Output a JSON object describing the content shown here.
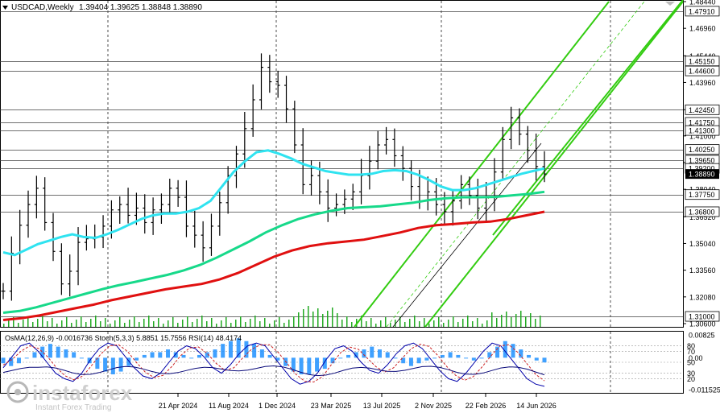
{
  "header": {
    "symbol": "USDCAD,Weekly",
    "ohlc": "1.39404 1.39625 1.38848 1.38890",
    "indicator_line": "OsMA(12,26,9) -0.0016736  Stoch(5,3,3) 5.8851 15.7556  RSI(14) 48.4174"
  },
  "brand": {
    "name": "instaforex",
    "tagline": "Instant Forex Trading"
  },
  "colors": {
    "ma_fast": "#2fe3f0",
    "ma_mid": "#17d98a",
    "ma_slow": "#e01010",
    "channel": "#33cc11",
    "candle": "#000000",
    "volume": "#22aa22",
    "osma": "#1e90ff",
    "stoch_main": "#0000aa",
    "stoch_signal": "#cc2222"
  },
  "chart_data": [
    {
      "type": "line",
      "title": "USDCAD,Weekly",
      "ylim": [
        1.306,
        1.4844
      ],
      "y_ticks": [
        "1.48440",
        "1.46960",
        "1.45440",
        "1.43960",
        "1.42450",
        "1.41000",
        "1.39520",
        "1.38040",
        "1.36520",
        "1.35040",
        "1.33560",
        "1.32080",
        "1.30600"
      ],
      "level_labels": [
        "1.47910",
        "1.45150",
        "1.44600",
        "1.42450",
        "1.41750",
        "1.41300",
        "1.40250",
        "1.39650",
        "1.39200",
        "1.37750",
        "1.36800",
        "1.31000"
      ],
      "x_ticks": [
        "21 Apr 2024",
        "11 Aug 2024",
        "1 Dec 2024",
        "23 Mar 2025",
        "13 Jul 2025",
        "2 Nov 2025",
        "22 Feb 2026",
        "14 Jun 2026"
      ],
      "price_close": [
        1.324,
        1.345,
        1.3605,
        1.372,
        1.381,
        1.362,
        1.346,
        1.328,
        1.335,
        1.351,
        1.353,
        1.354,
        1.36,
        1.369,
        1.372,
        1.366,
        1.37,
        1.362,
        1.369,
        1.372,
        1.381,
        1.376,
        1.36,
        1.355,
        1.348,
        1.36,
        1.373,
        1.388,
        1.4,
        1.414,
        1.43,
        1.448,
        1.44,
        1.438,
        1.425,
        1.405,
        1.383,
        1.388,
        1.379,
        1.37,
        1.372,
        1.375,
        1.379,
        1.388,
        1.396,
        1.405,
        1.408,
        1.399,
        1.392,
        1.382,
        1.374,
        1.379,
        1.372,
        1.368,
        1.374,
        1.383,
        1.377,
        1.37,
        1.376,
        1.39,
        1.408,
        1.42,
        1.411,
        1.402,
        1.393,
        1.3889
      ],
      "series": [
        {
          "name": "MA fast",
          "values": [
            1.3455,
            1.344,
            1.347,
            1.35,
            1.352,
            1.354,
            1.3555,
            1.354,
            1.3535,
            1.3555,
            1.358,
            1.361,
            1.364,
            1.366,
            1.367,
            1.367,
            1.368,
            1.37,
            1.374,
            1.382,
            1.39,
            1.396,
            1.401,
            1.402,
            1.4,
            1.3975,
            1.3945,
            1.3925,
            1.3905,
            1.3895,
            1.3885,
            1.3885,
            1.389,
            1.3905,
            1.391,
            1.3905,
            1.3885,
            1.3855,
            1.382,
            1.38,
            1.38,
            1.381,
            1.383,
            1.385,
            1.387,
            1.389,
            1.3905,
            1.392
          ]
        },
        {
          "name": "MA mid",
          "values": [
            1.312,
            1.313,
            1.315,
            1.3175,
            1.32,
            1.3225,
            1.325,
            1.3272,
            1.329,
            1.331,
            1.333,
            1.3355,
            1.3385,
            1.3425,
            1.347,
            1.3515,
            1.3565,
            1.3605,
            1.364,
            1.3665,
            1.3685,
            1.37,
            1.3705,
            1.371,
            1.372,
            1.373,
            1.3745,
            1.3755,
            1.376,
            1.376,
            1.3762,
            1.377,
            1.3778,
            1.379
          ]
        },
        {
          "name": "MA slow",
          "values": [
            1.308,
            1.309,
            1.3105,
            1.3125,
            1.3145,
            1.3165,
            1.319,
            1.321,
            1.323,
            1.325,
            1.3265,
            1.328,
            1.3305,
            1.334,
            1.3385,
            1.343,
            1.3465,
            1.349,
            1.3505,
            1.3515,
            1.3525,
            1.3545,
            1.3565,
            1.359,
            1.3605,
            1.3612,
            1.362,
            1.3625,
            1.364,
            1.366,
            1.368
          ]
        }
      ]
    },
    {
      "type": "bar",
      "title": "OsMA(12,26,9)",
      "ylim": [
        -0.011525,
        0.00825
      ],
      "y_ticks": [
        "0.00825",
        "0.00",
        "-0.011525"
      ],
      "values": [
        -0.002,
        -0.003,
        -0.002,
        0.0,
        0.002,
        0.004,
        0.005,
        0.004,
        0.003,
        0.002,
        0.0,
        -0.002,
        -0.004,
        -0.005,
        -0.006,
        -0.005,
        -0.003,
        -0.001,
        0.001,
        0.002,
        0.002,
        0.003,
        0.002,
        0.001,
        0.0,
        0.001,
        0.002,
        0.003,
        0.005,
        0.006,
        0.007,
        0.006,
        0.005,
        0.003,
        0.001,
        -0.001,
        -0.003,
        -0.005,
        -0.006,
        -0.006,
        -0.005,
        -0.004,
        -0.002,
        0.0,
        0.001,
        0.002,
        0.003,
        0.004,
        0.003,
        0.002,
        0.0,
        -0.002,
        -0.003,
        -0.002,
        -0.001,
        0.0,
        0.001,
        0.002,
        0.001,
        0.0,
        -0.001,
        0.0,
        0.002,
        0.004,
        0.006,
        0.005,
        0.003,
        0.001,
        -0.001,
        -0.0017
      ],
      "stoch_ticks": [
        "80",
        "70",
        "50",
        "30",
        "20"
      ],
      "stoch_main": [
        40,
        60,
        80,
        85,
        70,
        50,
        30,
        20,
        15,
        30,
        55,
        75,
        85,
        80,
        60,
        40,
        25,
        20,
        30,
        50,
        70,
        80,
        75,
        60,
        40,
        30,
        45,
        65,
        80,
        85,
        80,
        60,
        40,
        20,
        10,
        15,
        30,
        55,
        75,
        80,
        70,
        50,
        35,
        30,
        45,
        65,
        80,
        85,
        75,
        55,
        35,
        20,
        15,
        30,
        50,
        70,
        85,
        80,
        60,
        40,
        20,
        10,
        6
      ],
      "stoch_signal": [
        45,
        55,
        70,
        80,
        75,
        60,
        40,
        25,
        18,
        25,
        45,
        65,
        80,
        82,
        70,
        50,
        32,
        22,
        26,
        42,
        62,
        76,
        78,
        66,
        48,
        35,
        40,
        58,
        74,
        82,
        82,
        68,
        48,
        28,
        15,
        14,
        24,
        46,
        67,
        78,
        74,
        58,
        42,
        32,
        40,
        58,
        75,
        83,
        79,
        62,
        42,
        26,
        17,
        24,
        42,
        62,
        80,
        82,
        68,
        48,
        28,
        16
      ]
    }
  ]
}
